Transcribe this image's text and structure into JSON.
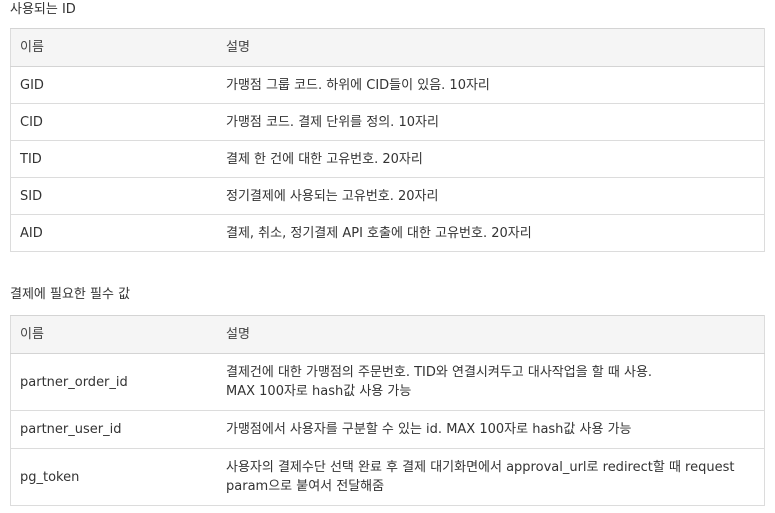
{
  "sections": [
    {
      "title": "사용되는 ID",
      "headers": [
        "이름",
        "설명"
      ],
      "rows": [
        {
          "name": "GID",
          "desc": [
            "가맹점 그룹 코드. 하위에 CID들이 있음. 10자리"
          ]
        },
        {
          "name": "CID",
          "desc": [
            "가맹점 코드. 결제 단위를 정의. 10자리"
          ]
        },
        {
          "name": "TID",
          "desc": [
            "결제 한 건에 대한 고유번호. 20자리"
          ]
        },
        {
          "name": "SID",
          "desc": [
            "정기결제에 사용되는 고유번호. 20자리"
          ]
        },
        {
          "name": "AID",
          "desc": [
            "결제, 취소, 정기결제 API 호출에 대한 고유번호. 20자리"
          ]
        }
      ]
    },
    {
      "title": "결제에 필요한 필수 값",
      "headers": [
        "이름",
        "설명"
      ],
      "rows": [
        {
          "name": "partner_order_id",
          "desc": [
            "결제건에 대한 가맹점의 주문번호. TID와 연결시켜두고 대사작업을 할 때 사용.",
            "MAX 100자로 hash값 사용 가능"
          ]
        },
        {
          "name": "partner_user_id",
          "desc": [
            "가맹점에서 사용자를 구분할 수 있는 id. MAX 100자로 hash값 사용 가능"
          ]
        },
        {
          "name": "pg_token",
          "desc": [
            "사용자의 결제수단 선택 완료 후 결제 대기화면에서 approval_url로 redirect할 때 request",
            "param으로 붙여서 전달해줌"
          ]
        }
      ]
    }
  ]
}
